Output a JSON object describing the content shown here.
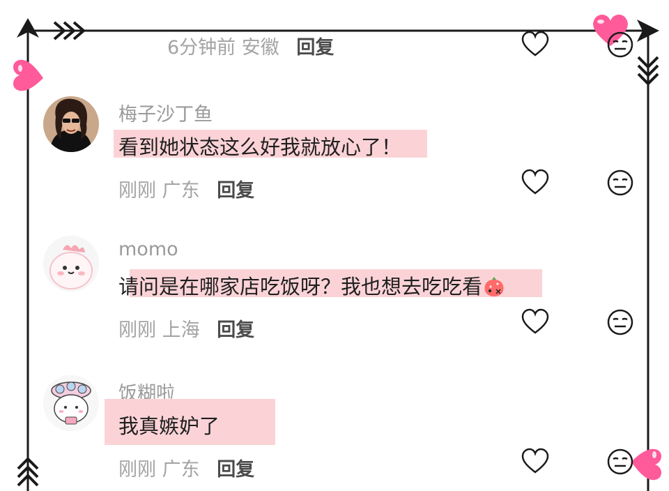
{
  "top_item": {
    "time": "6分钟前",
    "location": "安徽",
    "reply": "回复"
  },
  "comments": [
    {
      "username": "梅子沙丁鱼",
      "text": "看到她状态这么好我就放心了！",
      "time": "刚刚",
      "location": "广东",
      "reply": "回复",
      "avatar": "woman-sunglasses"
    },
    {
      "username": "momo",
      "text": "请问是在哪家店吃饭呀？我也想去吃吃看",
      "time": "刚刚",
      "location": "上海",
      "reply": "回复",
      "avatar": "pink-dino-cartoon",
      "trailing_emoji": "shy-strawberry-emoji"
    },
    {
      "username": "饭糊啦",
      "text": "我真嫉妒了",
      "time": "刚刚",
      "location": "广东",
      "reply": "回复",
      "avatar": "bun-cartoon"
    }
  ],
  "icons": {
    "like": "heart-outline-icon",
    "dislike": "neutral-face-icon"
  },
  "colors": {
    "highlight": "#fbd3d7",
    "frame": "#1a1a1a",
    "heart_pink": "#ff5a9a"
  }
}
